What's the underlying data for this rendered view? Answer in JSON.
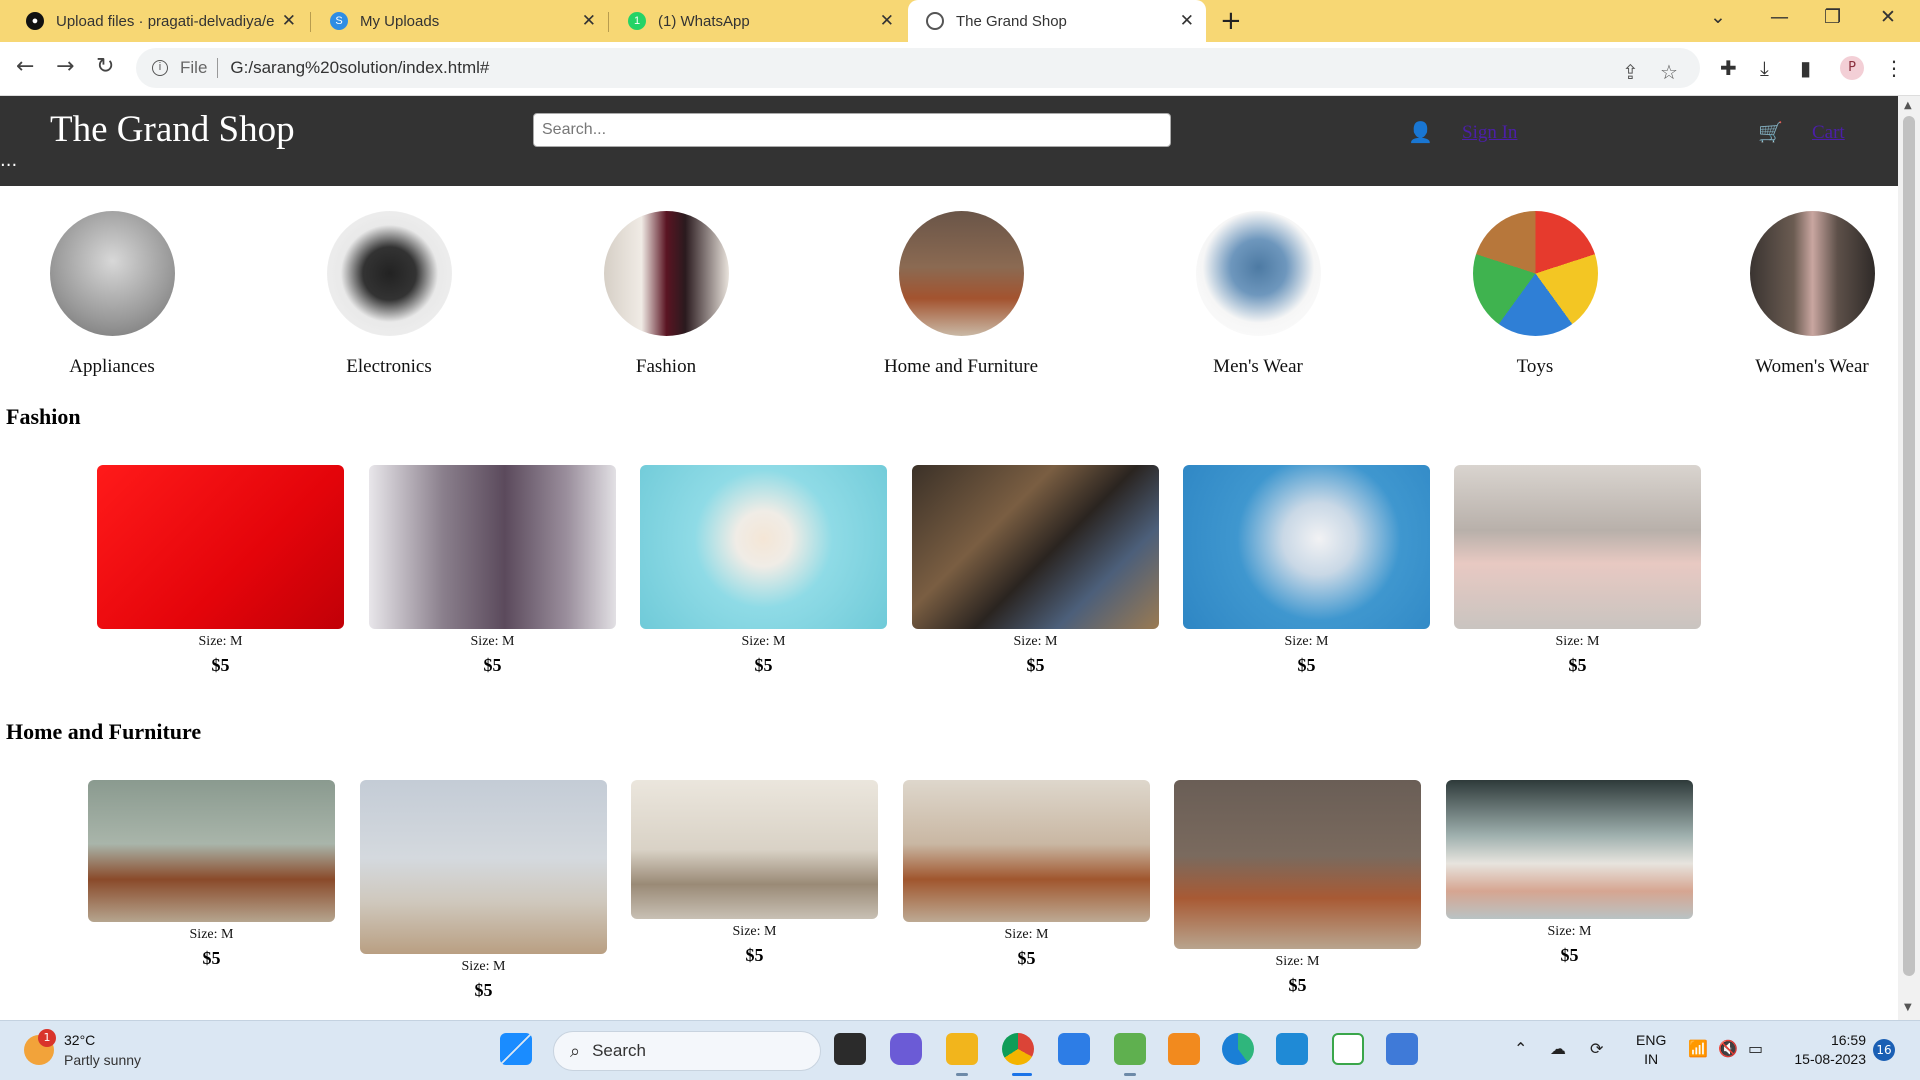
{
  "browser": {
    "tabs": [
      {
        "title": "Upload files · pragati-delvadiya/e",
        "icon": "github-icon",
        "active": false
      },
      {
        "title": "My Uploads",
        "icon": "uploads-icon",
        "active": false
      },
      {
        "title": "(1) WhatsApp",
        "icon": "whatsapp-icon",
        "active": false
      },
      {
        "title": "The Grand Shop",
        "icon": "globe-icon",
        "active": true
      }
    ],
    "address": {
      "scheme": "File",
      "url": "G:/sarang%20solution/index.html#"
    },
    "profile_initial": "P"
  },
  "site": {
    "brand": "The Grand Shop",
    "dots": "...",
    "search_placeholder": "Search...",
    "signin_label": "Sign In",
    "cart_label": "Cart"
  },
  "categories": [
    {
      "label": "Appliances",
      "icon": "appliances-image"
    },
    {
      "label": "Electronics",
      "icon": "camera-image"
    },
    {
      "label": "Fashion",
      "icon": "fashion-image"
    },
    {
      "label": "Home and Furniture",
      "icon": "furniture-image"
    },
    {
      "label": "Men's Wear",
      "icon": "mens-wear-image"
    },
    {
      "label": "Toys",
      "icon": "toys-image"
    },
    {
      "label": "Women's Wear",
      "icon": "womens-wear-image"
    }
  ],
  "sections": [
    {
      "title": "Fashion",
      "products": [
        {
          "size": "Size: M",
          "price": "$5",
          "color": "#e4040a"
        },
        {
          "size": "Size: M",
          "price": "$5",
          "color": "#8a7f8c"
        },
        {
          "size": "Size: M",
          "price": "$5",
          "color": "#8fdbe6"
        },
        {
          "size": "Size: M",
          "price": "$5",
          "color": "#5a4a3a"
        },
        {
          "size": "Size: M",
          "price": "$5",
          "color": "#3f97cf"
        },
        {
          "size": "Size: M",
          "price": "$5",
          "color": "#c9c4c0"
        }
      ]
    },
    {
      "title": "Home and Furniture",
      "products": [
        {
          "size": "Size: M",
          "price": "$5",
          "color": "#9aa79d"
        },
        {
          "size": "Size: M",
          "price": "$5",
          "color": "#c8d0d7"
        },
        {
          "size": "Size: M",
          "price": "$5",
          "color": "#d9d2c6"
        },
        {
          "size": "Size: M",
          "price": "$5",
          "color": "#c9b7a3"
        },
        {
          "size": "Size: M",
          "price": "$5",
          "color": "#7a6a5e"
        },
        {
          "size": "Size: M",
          "price": "$5",
          "color": "#b9c3c4"
        }
      ]
    }
  ],
  "taskbar": {
    "temperature": "32°C",
    "condition": "Partly sunny",
    "weather_badge": "1",
    "search_label": "Search",
    "lang_line1": "ENG",
    "lang_line2": "IN",
    "time": "16:59",
    "date": "15-08-2023",
    "notifications": "16"
  }
}
